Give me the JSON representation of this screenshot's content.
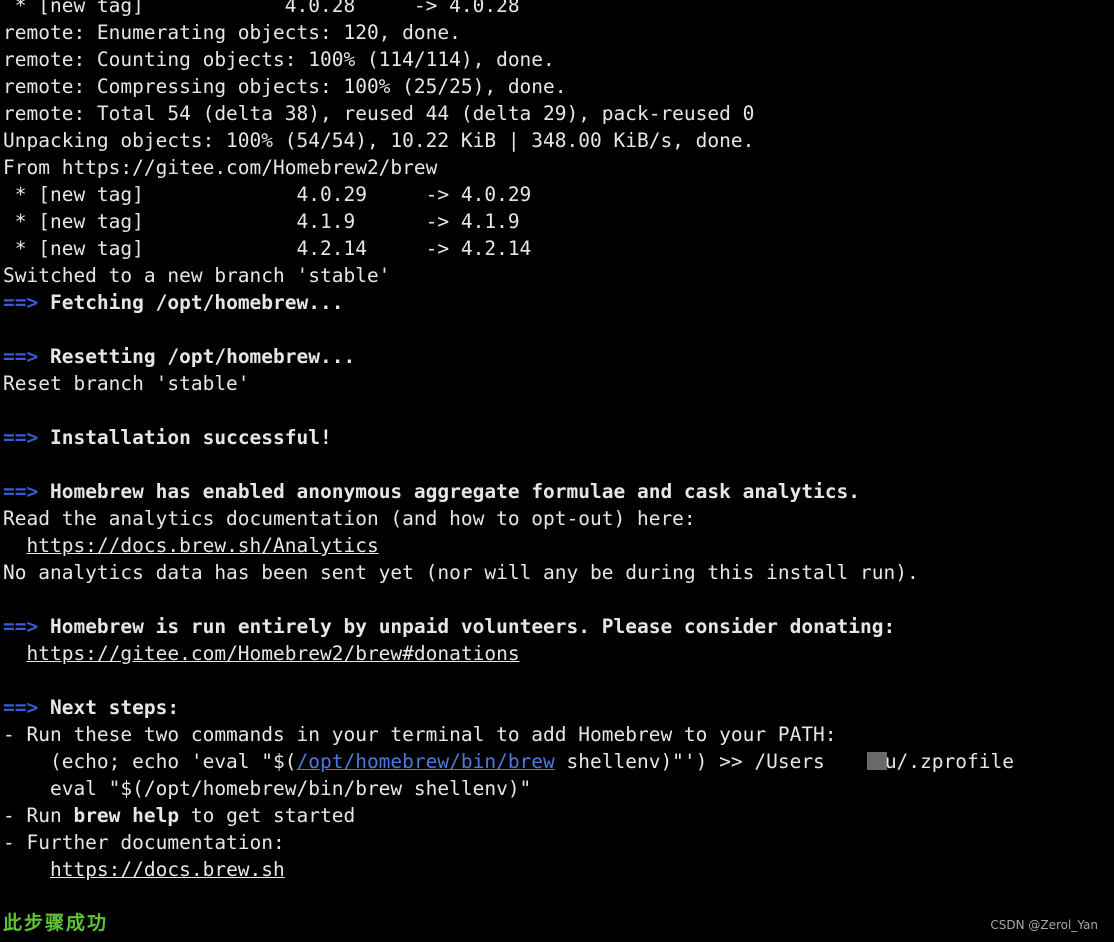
{
  "colors": {
    "background": "#000000",
    "text": "#e6e6e6",
    "arrow": "#3a5bd9",
    "link_highlight": "#4b7bd8",
    "note": "#5ec434"
  },
  "terminal": {
    "top_partial": " * [new tag]            4.0.28     -> 4.0.28",
    "remote": [
      "remote: Enumerating objects: 120, done.",
      "remote: Counting objects: 100% (114/114), done.",
      "remote: Compressing objects: 100% (25/25), done.",
      "remote: Total 54 (delta 38), reused 44 (delta 29), pack-reused 0"
    ],
    "unpacking": "Unpacking objects: 100% (54/54), 10.22 KiB | 348.00 KiB/s, done.",
    "from": "From https://gitee.com/Homebrew2/brew",
    "tags": [
      " * [new tag]             4.0.29     -> 4.0.29",
      " * [new tag]             4.1.9      -> 4.1.9",
      " * [new tag]             4.2.14     -> 4.2.14"
    ],
    "switched": "Switched to a new branch 'stable'",
    "arrow": "==>",
    "fetching": " Fetching /opt/homebrew...",
    "resetting": " Resetting /opt/homebrew...",
    "reset_branch": "Reset branch 'stable'",
    "install_success": " Installation successful!",
    "analytics_heading": " Homebrew has enabled anonymous aggregate formulae and cask analytics.",
    "analytics_read": "Read the analytics documentation (and how to opt-out) here:",
    "analytics_link": "https://docs.brew.sh/Analytics",
    "analytics_none": "No analytics data has been sent yet (nor will any be during this install run).",
    "donate_heading": " Homebrew is run entirely by unpaid volunteers. Please consider donating:",
    "donate_link": "https://gitee.com/Homebrew2/brew#donations",
    "next_steps": " Next steps:",
    "run_two": "- Run these two commands in your terminal to add Homebrew to your PATH:",
    "cmd1_prefix": "    (echo; echo 'eval \"$(",
    "cmd1_link": "/opt/homebrew/bin/brew",
    "cmd1_middle": " shellenv)\"') >> /Users",
    "cmd1_suffix": "u/.zprofile",
    "cmd2": "    eval \"$(/opt/homebrew/bin/brew shellenv)\"",
    "run_help_prefix": "- Run ",
    "run_help_cmd": "brew help",
    "run_help_suffix": " to get started",
    "further_docs": "- Further documentation:",
    "docs_link": "https://docs.brew.sh"
  },
  "note": "此步骤成功",
  "watermark": "CSDN @Zerol_Yan"
}
